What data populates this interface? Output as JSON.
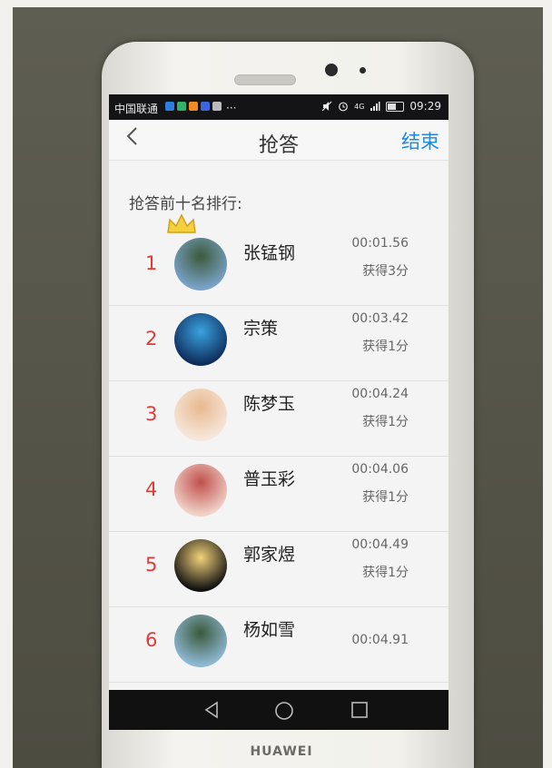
{
  "status_bar": {
    "carrier": "中国联通",
    "overflow": "···",
    "network": "4G",
    "time": "09:29",
    "app_icon_colors": [
      "#2f7de1",
      "#2fb36a",
      "#f08a24",
      "#3f64e0",
      "#bbbbbb"
    ]
  },
  "nav": {
    "back_icon": "chevron-left-icon",
    "title": "抢答",
    "end_label": "结束"
  },
  "section_title": "抢答前十名排行:",
  "rankings": [
    {
      "rank": "1",
      "name": "张锰钢",
      "time": "00:01.56",
      "score": "获得3分",
      "avatar_colors": [
        "#7aa3c9",
        "#3c5a3a"
      ],
      "crown": true
    },
    {
      "rank": "2",
      "name": "宗策",
      "time": "00:03.42",
      "score": "获得1分",
      "avatar_colors": [
        "#0f2c5c",
        "#3aa3e0"
      ]
    },
    {
      "rank": "3",
      "name": "陈梦玉",
      "time": "00:04.24",
      "score": "获得1分",
      "avatar_colors": [
        "#f6e7dc",
        "#e8b98f"
      ]
    },
    {
      "rank": "4",
      "name": "普玉彩",
      "time": "00:04.06",
      "score": "获得1分",
      "avatar_colors": [
        "#f1d3c8",
        "#c0504d"
      ]
    },
    {
      "rank": "5",
      "name": "郭家煜",
      "time": "00:04.49",
      "score": "获得1分",
      "avatar_colors": [
        "#111111",
        "#f3d27a"
      ]
    },
    {
      "rank": "6",
      "name": "杨如雪",
      "time": "00:04.91",
      "score": "",
      "avatar_colors": [
        "#8fb9d6",
        "#3a5a3a"
      ]
    }
  ],
  "device_brand": "HUAWEI",
  "system_nav": [
    "back-triangle-icon",
    "home-circle-icon",
    "recents-square-icon"
  ]
}
